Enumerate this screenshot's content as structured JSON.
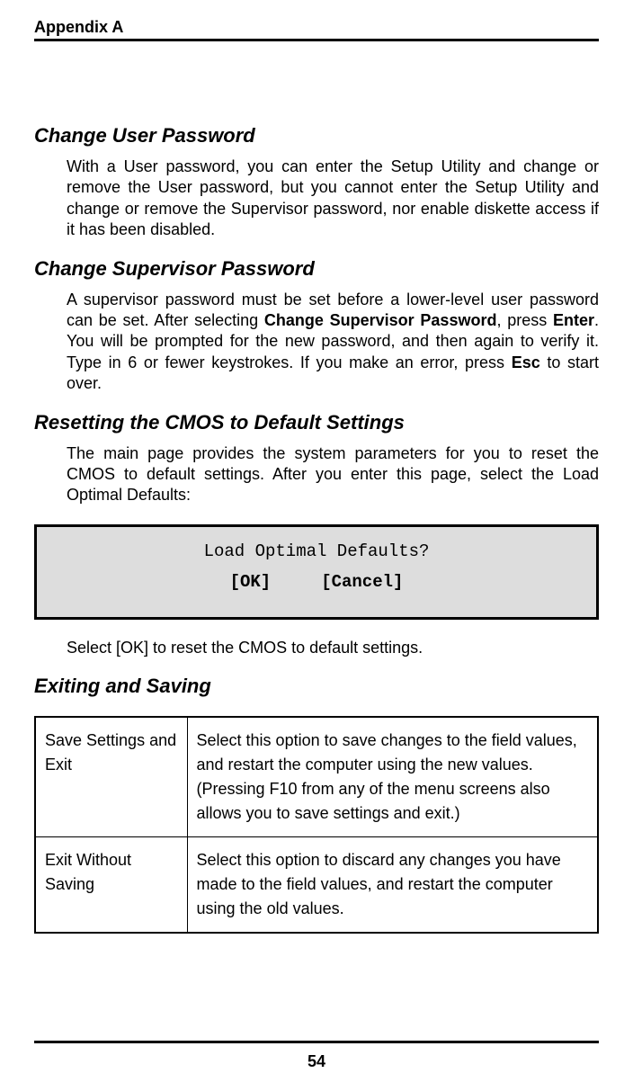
{
  "header": "Appendix A",
  "sections": {
    "s1_heading": "Change User Password",
    "s1_body": "With a User password, you can enter the Setup Utility and change or remove the User password, but you cannot enter the Setup Utility and change or remove the Supervisor password, nor enable diskette access if it has been disabled.",
    "s2_heading": "Change Supervisor Password",
    "s2_body_pre": "A supervisor password must be set before a lower-level user password can be set. After selecting ",
    "s2_bold1": "Change Supervisor Password",
    "s2_body_mid1": ", press ",
    "s2_bold2": "Enter",
    "s2_body_mid2": ". You will be prompted for the new password, and then again to verify it. Type in 6 or fewer keystrokes. If you make an error, press ",
    "s2_bold3": "Esc",
    "s2_body_post": " to start over.",
    "s3_heading": "Resetting the CMOS to Default Settings",
    "s3_body": "The main page provides the system parameters for you to reset the CMOS to default settings. After you enter this page, select the Load Optimal Defaults:",
    "dialog_title": "Load Optimal Defaults?",
    "dialog_ok": "[OK]",
    "dialog_cancel": "[Cancel]",
    "s3_body2": "Select [OK] to reset the CMOS to default settings.",
    "s4_heading": "Exiting and Saving"
  },
  "table": {
    "row1_left": "Save Settings and Exit",
    "row1_right": "Select this option to save changes to the field values, and restart the computer using the new values. (Pressing F10 from any of the menu screens also allows you to save settings and exit.)",
    "row2_left": "Exit Without Saving",
    "row2_right": "Select this option to discard any changes you have made to the field values, and restart the computer using the old values."
  },
  "page_number": "54"
}
